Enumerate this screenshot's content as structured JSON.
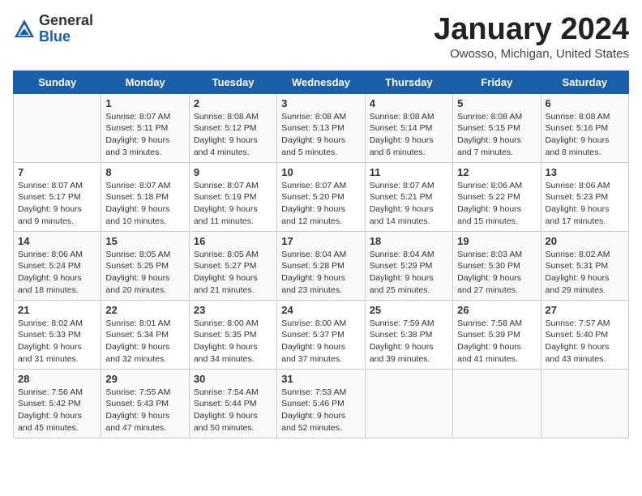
{
  "logo": {
    "general": "General",
    "blue": "Blue"
  },
  "header": {
    "title": "January 2024",
    "subtitle": "Owosso, Michigan, United States"
  },
  "weekdays": [
    "Sunday",
    "Monday",
    "Tuesday",
    "Wednesday",
    "Thursday",
    "Friday",
    "Saturday"
  ],
  "weeks": [
    [
      {
        "day": "",
        "sunrise": "",
        "sunset": "",
        "daylight": ""
      },
      {
        "day": "1",
        "sunrise": "Sunrise: 8:07 AM",
        "sunset": "Sunset: 5:11 PM",
        "daylight": "Daylight: 9 hours and 3 minutes."
      },
      {
        "day": "2",
        "sunrise": "Sunrise: 8:08 AM",
        "sunset": "Sunset: 5:12 PM",
        "daylight": "Daylight: 9 hours and 4 minutes."
      },
      {
        "day": "3",
        "sunrise": "Sunrise: 8:08 AM",
        "sunset": "Sunset: 5:13 PM",
        "daylight": "Daylight: 9 hours and 5 minutes."
      },
      {
        "day": "4",
        "sunrise": "Sunrise: 8:08 AM",
        "sunset": "Sunset: 5:14 PM",
        "daylight": "Daylight: 9 hours and 6 minutes."
      },
      {
        "day": "5",
        "sunrise": "Sunrise: 8:08 AM",
        "sunset": "Sunset: 5:15 PM",
        "daylight": "Daylight: 9 hours and 7 minutes."
      },
      {
        "day": "6",
        "sunrise": "Sunrise: 8:08 AM",
        "sunset": "Sunset: 5:16 PM",
        "daylight": "Daylight: 9 hours and 8 minutes."
      }
    ],
    [
      {
        "day": "7",
        "sunrise": "Sunrise: 8:07 AM",
        "sunset": "Sunset: 5:17 PM",
        "daylight": "Daylight: 9 hours and 9 minutes."
      },
      {
        "day": "8",
        "sunrise": "Sunrise: 8:07 AM",
        "sunset": "Sunset: 5:18 PM",
        "daylight": "Daylight: 9 hours and 10 minutes."
      },
      {
        "day": "9",
        "sunrise": "Sunrise: 8:07 AM",
        "sunset": "Sunset: 5:19 PM",
        "daylight": "Daylight: 9 hours and 11 minutes."
      },
      {
        "day": "10",
        "sunrise": "Sunrise: 8:07 AM",
        "sunset": "Sunset: 5:20 PM",
        "daylight": "Daylight: 9 hours and 12 minutes."
      },
      {
        "day": "11",
        "sunrise": "Sunrise: 8:07 AM",
        "sunset": "Sunset: 5:21 PM",
        "daylight": "Daylight: 9 hours and 14 minutes."
      },
      {
        "day": "12",
        "sunrise": "Sunrise: 8:06 AM",
        "sunset": "Sunset: 5:22 PM",
        "daylight": "Daylight: 9 hours and 15 minutes."
      },
      {
        "day": "13",
        "sunrise": "Sunrise: 8:06 AM",
        "sunset": "Sunset: 5:23 PM",
        "daylight": "Daylight: 9 hours and 17 minutes."
      }
    ],
    [
      {
        "day": "14",
        "sunrise": "Sunrise: 8:06 AM",
        "sunset": "Sunset: 5:24 PM",
        "daylight": "Daylight: 9 hours and 18 minutes."
      },
      {
        "day": "15",
        "sunrise": "Sunrise: 8:05 AM",
        "sunset": "Sunset: 5:25 PM",
        "daylight": "Daylight: 9 hours and 20 minutes."
      },
      {
        "day": "16",
        "sunrise": "Sunrise: 8:05 AM",
        "sunset": "Sunset: 5:27 PM",
        "daylight": "Daylight: 9 hours and 21 minutes."
      },
      {
        "day": "17",
        "sunrise": "Sunrise: 8:04 AM",
        "sunset": "Sunset: 5:28 PM",
        "daylight": "Daylight: 9 hours and 23 minutes."
      },
      {
        "day": "18",
        "sunrise": "Sunrise: 8:04 AM",
        "sunset": "Sunset: 5:29 PM",
        "daylight": "Daylight: 9 hours and 25 minutes."
      },
      {
        "day": "19",
        "sunrise": "Sunrise: 8:03 AM",
        "sunset": "Sunset: 5:30 PM",
        "daylight": "Daylight: 9 hours and 27 minutes."
      },
      {
        "day": "20",
        "sunrise": "Sunrise: 8:02 AM",
        "sunset": "Sunset: 5:31 PM",
        "daylight": "Daylight: 9 hours and 29 minutes."
      }
    ],
    [
      {
        "day": "21",
        "sunrise": "Sunrise: 8:02 AM",
        "sunset": "Sunset: 5:33 PM",
        "daylight": "Daylight: 9 hours and 31 minutes."
      },
      {
        "day": "22",
        "sunrise": "Sunrise: 8:01 AM",
        "sunset": "Sunset: 5:34 PM",
        "daylight": "Daylight: 9 hours and 32 minutes."
      },
      {
        "day": "23",
        "sunrise": "Sunrise: 8:00 AM",
        "sunset": "Sunset: 5:35 PM",
        "daylight": "Daylight: 9 hours and 34 minutes."
      },
      {
        "day": "24",
        "sunrise": "Sunrise: 8:00 AM",
        "sunset": "Sunset: 5:37 PM",
        "daylight": "Daylight: 9 hours and 37 minutes."
      },
      {
        "day": "25",
        "sunrise": "Sunrise: 7:59 AM",
        "sunset": "Sunset: 5:38 PM",
        "daylight": "Daylight: 9 hours and 39 minutes."
      },
      {
        "day": "26",
        "sunrise": "Sunrise: 7:58 AM",
        "sunset": "Sunset: 5:39 PM",
        "daylight": "Daylight: 9 hours and 41 minutes."
      },
      {
        "day": "27",
        "sunrise": "Sunrise: 7:57 AM",
        "sunset": "Sunset: 5:40 PM",
        "daylight": "Daylight: 9 hours and 43 minutes."
      }
    ],
    [
      {
        "day": "28",
        "sunrise": "Sunrise: 7:56 AM",
        "sunset": "Sunset: 5:42 PM",
        "daylight": "Daylight: 9 hours and 45 minutes."
      },
      {
        "day": "29",
        "sunrise": "Sunrise: 7:55 AM",
        "sunset": "Sunset: 5:43 PM",
        "daylight": "Daylight: 9 hours and 47 minutes."
      },
      {
        "day": "30",
        "sunrise": "Sunrise: 7:54 AM",
        "sunset": "Sunset: 5:44 PM",
        "daylight": "Daylight: 9 hours and 50 minutes."
      },
      {
        "day": "31",
        "sunrise": "Sunrise: 7:53 AM",
        "sunset": "Sunset: 5:46 PM",
        "daylight": "Daylight: 9 hours and 52 minutes."
      },
      {
        "day": "",
        "sunrise": "",
        "sunset": "",
        "daylight": ""
      },
      {
        "day": "",
        "sunrise": "",
        "sunset": "",
        "daylight": ""
      },
      {
        "day": "",
        "sunrise": "",
        "sunset": "",
        "daylight": ""
      }
    ]
  ]
}
